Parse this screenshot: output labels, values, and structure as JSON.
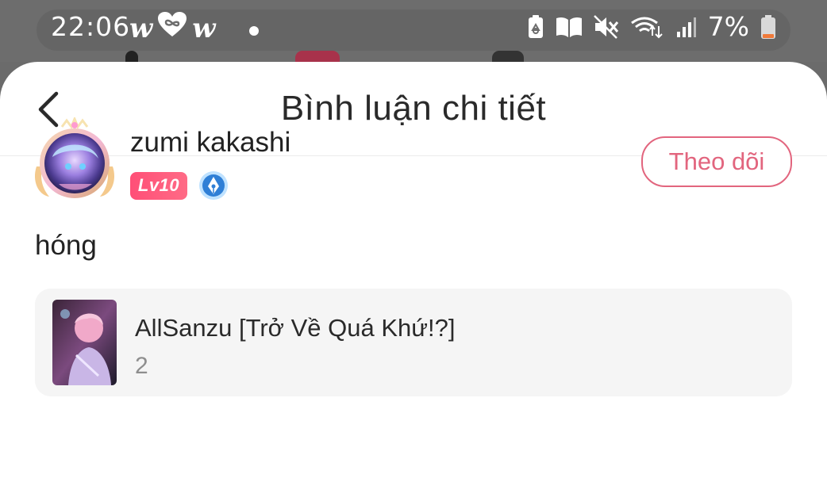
{
  "status_bar": {
    "time": "22:06",
    "notif_left": "w",
    "notif_right": "w",
    "battery_percent": "7%"
  },
  "header": {
    "title": "Bình luận chi tiết"
  },
  "comment": {
    "username": "zumi kakashi",
    "level": "Lv10",
    "follow_label": "Theo dõi",
    "text": "hóng"
  },
  "story": {
    "title": "AllSanzu [Trở Về Quá Khứ!?]",
    "count": "2"
  },
  "colors": {
    "accent": "#e2657e",
    "level_badge": "#ff5a7d",
    "card_bg": "#f5f5f5",
    "status_bg": "#6d6d6d"
  }
}
